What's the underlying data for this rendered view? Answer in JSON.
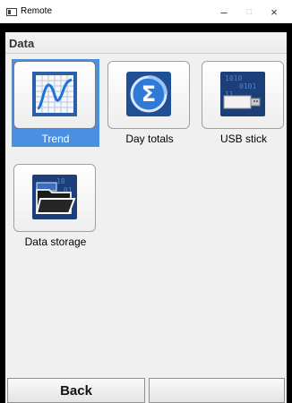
{
  "window": {
    "title": "Remote",
    "minimize_glyph": "–",
    "maximize_glyph": "□",
    "close_glyph": "×"
  },
  "section": {
    "title": "Data"
  },
  "tiles": [
    {
      "label": "Trend",
      "icon": "trend-chart-icon",
      "selected": true
    },
    {
      "label": "Day totals",
      "icon": "sigma-icon",
      "selected": false
    },
    {
      "label": "USB stick",
      "icon": "usb-stick-icon",
      "selected": false
    },
    {
      "label": "Data storage",
      "icon": "folder-icon",
      "selected": false
    }
  ],
  "softkeys": {
    "left": "Back",
    "right": ""
  },
  "colors": {
    "selection": "#4a90e2",
    "icon_blue": "#1f5fb0"
  }
}
